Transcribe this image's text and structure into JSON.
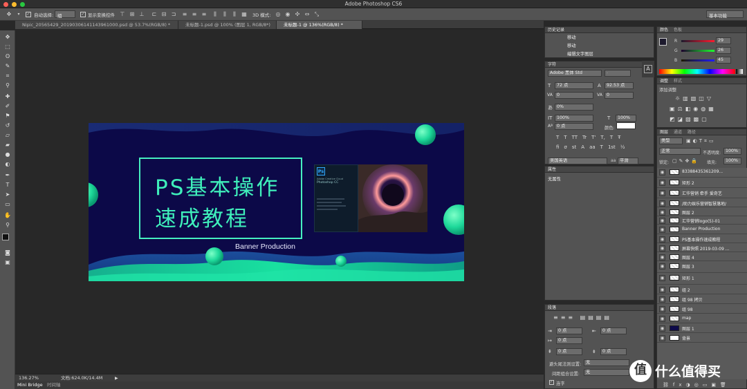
{
  "app": {
    "title": "Adobe Photoshop CS6",
    "workspace": "基本功能"
  },
  "options": {
    "auto_select_label": "自动选择:",
    "auto_select_value": "组",
    "show_transform_label": "显示变换控件",
    "mode_3d_label": "3D 模式:"
  },
  "tabs": [
    {
      "label": "Nipic_20565429_20190306141143961000.psd @ 53.7%(RGB/8) *"
    },
    {
      "label": "未标题-1.psd @ 100% (图层 1, RGB/8*)"
    },
    {
      "label": "未标题-1 @ 136%(RGB/8) *"
    }
  ],
  "banner": {
    "title_line1": "PS基本操作",
    "title_line2": "速成教程",
    "subtitle": "Banner Production",
    "ps_logo": "Ps",
    "ps_splash_brand": "Adobe Creative Cloud",
    "ps_splash_name": "Photoshop CC"
  },
  "status": {
    "zoom": "136.27%",
    "doc": "文档:624.0K/14.4M"
  },
  "bottom_tabs": [
    "Mini Bridge",
    "时间轴"
  ],
  "history": {
    "title": "历史记录",
    "items": [
      "移动",
      "移动",
      "编辑文字图层"
    ]
  },
  "character": {
    "title": "字符",
    "font": "Adobe 黑体 Std",
    "style": "-",
    "size": "72 点",
    "leading": "92.53 点",
    "kerning": "0",
    "tracking": "0",
    "scale_pct": "0%",
    "vscale": "100%",
    "hscale": "100%",
    "baseline": "0 点",
    "color_label": "颜色:",
    "language": "美国英语",
    "aa_label": "aa",
    "aa": "平滑",
    "style_buttons": [
      "T",
      "T",
      "TT",
      "Tr",
      "T'",
      "T,",
      "T",
      "Ŧ"
    ],
    "style_buttons2": [
      "fi",
      "σ",
      "st",
      "A",
      "aa",
      "T",
      "1st",
      "½"
    ]
  },
  "properties": {
    "title": "属性",
    "value": "无属性"
  },
  "paragraph": {
    "title": "段落",
    "indent_left": "0 点",
    "indent_right": "0 点",
    "first_line": "0 点",
    "space_before": "0 点",
    "space_after": "0 点",
    "hyphen_label": "避头尾法则设置:",
    "hyphen_value": "无",
    "compose_label": "间距组合设置:",
    "compose_value": "无",
    "hyphenate": "连字"
  },
  "color": {
    "title": "颜色",
    "tab2": "色板",
    "r": "29",
    "g": "26",
    "b": "45",
    "fg": "#1d1a2d"
  },
  "adjust": {
    "title": "调整",
    "tab2": "样式",
    "add": "添加调整"
  },
  "layers": {
    "tabs": [
      "图层",
      "通道",
      "路径"
    ],
    "filter": "类型",
    "blend": "正常",
    "opacity_label": "不透明度:",
    "opacity": "100%",
    "lock_label": "锁定:",
    "fill_label": "填充:",
    "fill": "100%",
    "items": [
      {
        "name": "83388435361209..."
      },
      {
        "name": "矩形 2"
      },
      {
        "name": "汇华营销 牵手 爱奇艺"
      },
      {
        "name": "/助力娱乐营销智慧落地/"
      },
      {
        "name": "图层 2"
      },
      {
        "name": "汇华营销logo(5)-01"
      },
      {
        "name": "Banner Production"
      },
      {
        "name": "PS基本操作速成教程"
      },
      {
        "name": "屏幕快照 2019-03-09 ..."
      },
      {
        "name": "图层 4"
      },
      {
        "name": "图层 3"
      },
      {
        "name": "矩形 1"
      },
      {
        "name": "组 2"
      },
      {
        "name": "组 98 拷贝"
      },
      {
        "name": "组 98"
      },
      {
        "name": "map"
      },
      {
        "name": "图层 1"
      },
      {
        "name": "背景"
      }
    ]
  },
  "watermark": "什么值得买"
}
